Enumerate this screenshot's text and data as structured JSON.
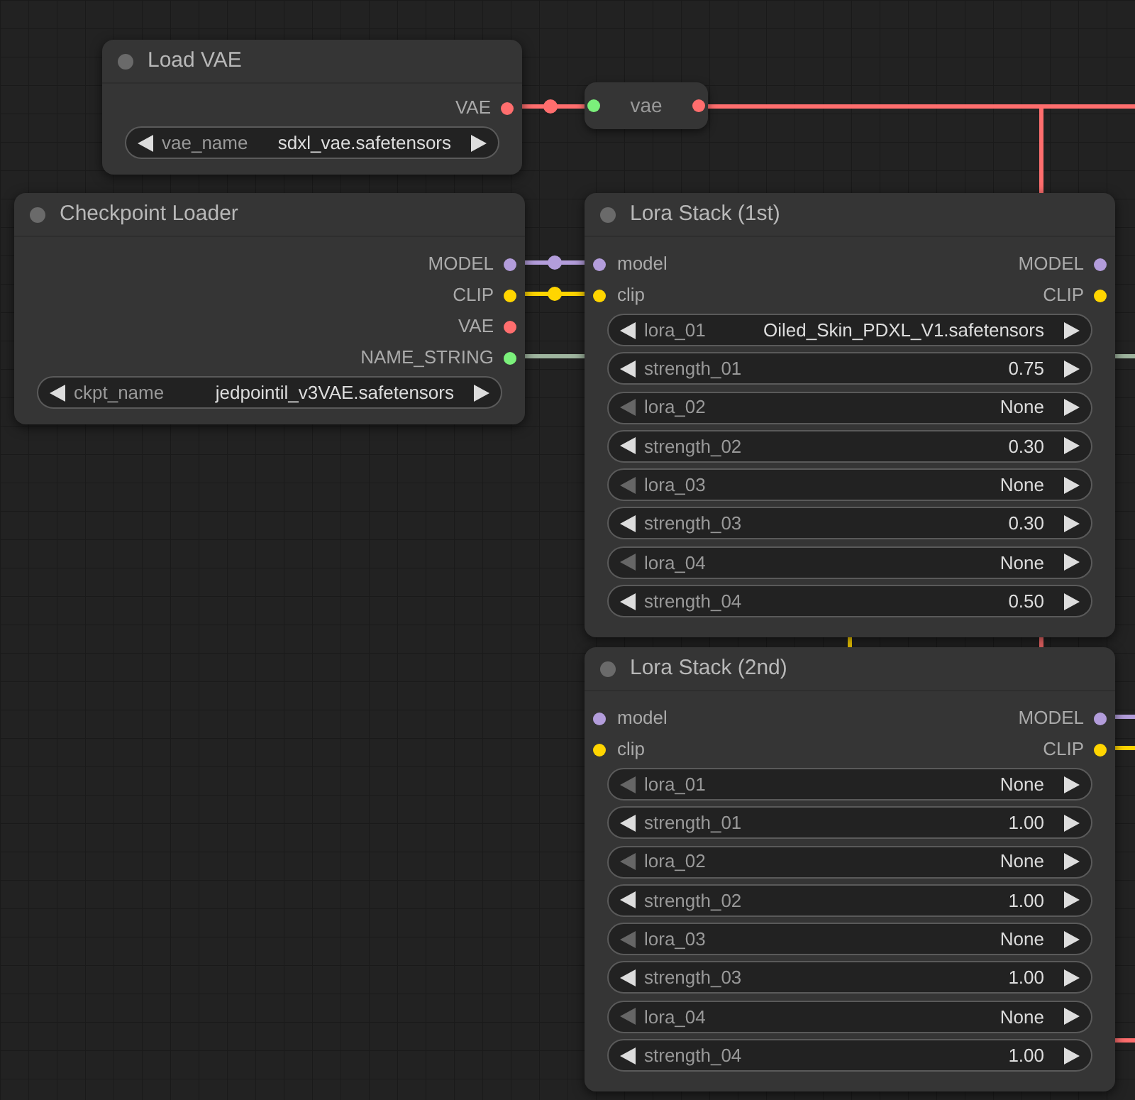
{
  "nodes": [
    {
      "kind": "node",
      "title": "Load VAE",
      "outputs": [
        {
          "label": "VAE",
          "color": "#ff6e6e"
        }
      ],
      "widgets": [
        {
          "label": "vae_name",
          "value": "sdxl_vae.safetensors",
          "prev_disabled": false
        }
      ]
    },
    {
      "kind": "reroute",
      "title": "vae",
      "inputs": [
        {
          "color": "#7bf07b"
        }
      ],
      "outputs": [
        {
          "color": "#ff6e6e"
        }
      ]
    },
    {
      "kind": "node",
      "title": "Checkpoint Loader",
      "outputs": [
        {
          "label": "MODEL",
          "color": "#b39ddb"
        },
        {
          "label": "CLIP",
          "color": "#ffd500"
        },
        {
          "label": "VAE",
          "color": "#ff6e6e"
        },
        {
          "label": "NAME_STRING",
          "color": "#7bf07b"
        }
      ],
      "widgets": [
        {
          "label": "ckpt_name",
          "value": "jedpointil_v3VAE.safetensors",
          "prev_disabled": false
        }
      ]
    },
    {
      "kind": "node",
      "title": "Lora Stack (1st)",
      "inputs": [
        {
          "label": "model",
          "color": "#b39ddb"
        },
        {
          "label": "clip",
          "color": "#ffd500"
        }
      ],
      "outputs": [
        {
          "label": "MODEL",
          "color": "#b39ddb"
        },
        {
          "label": "CLIP",
          "color": "#ffd500"
        }
      ],
      "widgets": [
        {
          "label": "lora_01",
          "value": "Oiled_Skin_PDXL_V1.safetensors",
          "prev_disabled": false
        },
        {
          "label": "strength_01",
          "value": "0.75",
          "prev_disabled": false
        },
        {
          "label": "lora_02",
          "value": "None",
          "prev_disabled": true
        },
        {
          "label": "strength_02",
          "value": "0.30",
          "prev_disabled": false
        },
        {
          "label": "lora_03",
          "value": "None",
          "prev_disabled": true
        },
        {
          "label": "strength_03",
          "value": "0.30",
          "prev_disabled": false
        },
        {
          "label": "lora_04",
          "value": "None",
          "prev_disabled": true
        },
        {
          "label": "strength_04",
          "value": "0.50",
          "prev_disabled": false
        }
      ]
    },
    {
      "kind": "node",
      "title": "Lora Stack (2nd)",
      "inputs": [
        {
          "label": "model",
          "color": "#b39ddb"
        },
        {
          "label": "clip",
          "color": "#ffd500"
        }
      ],
      "outputs": [
        {
          "label": "MODEL",
          "color": "#b39ddb"
        },
        {
          "label": "CLIP",
          "color": "#ffd500"
        }
      ],
      "widgets": [
        {
          "label": "lora_01",
          "value": "None",
          "prev_disabled": true
        },
        {
          "label": "strength_01",
          "value": "1.00",
          "prev_disabled": false
        },
        {
          "label": "lora_02",
          "value": "None",
          "prev_disabled": true
        },
        {
          "label": "strength_02",
          "value": "1.00",
          "prev_disabled": false
        },
        {
          "label": "lora_03",
          "value": "None",
          "prev_disabled": true
        },
        {
          "label": "strength_03",
          "value": "1.00",
          "prev_disabled": false
        },
        {
          "label": "lora_04",
          "value": "None",
          "prev_disabled": true
        },
        {
          "label": "strength_04",
          "value": "1.00",
          "prev_disabled": false
        }
      ]
    }
  ]
}
